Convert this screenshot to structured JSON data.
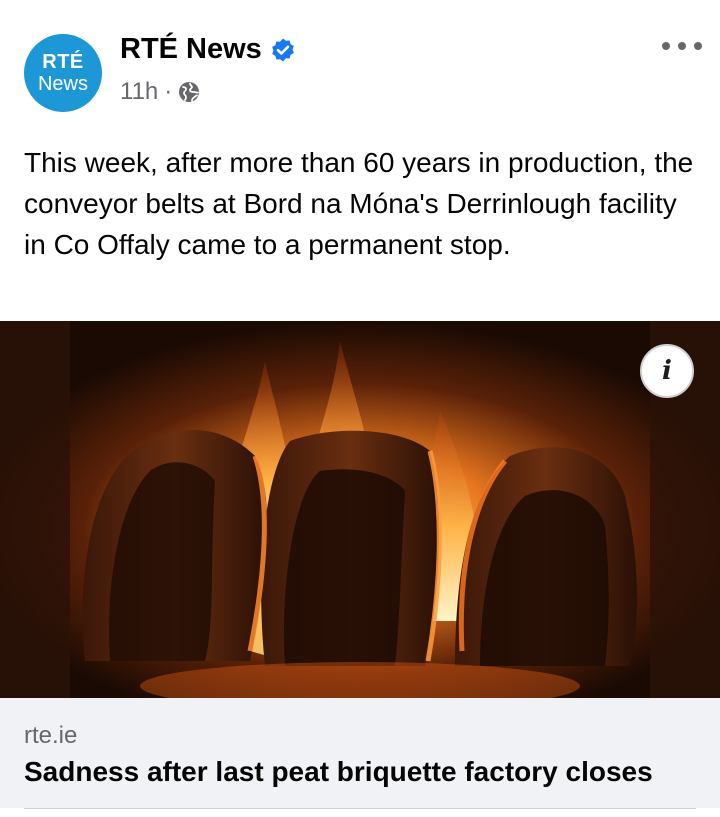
{
  "post": {
    "avatar": {
      "line1": "RTÉ",
      "line2": "News",
      "color": "#1e97d6"
    },
    "page_name": "RTÉ News",
    "verified_icon": "verified-badge-icon",
    "time": "11h",
    "separator": "·",
    "privacy_icon": "globe-icon",
    "more_icon": "more-options-icon",
    "text": "This week, after more than 60 years in production, the conveyor belts at Bord na Móna's Derrinlough facility in Co Offaly came to a permanent stop.",
    "image_icon": "info-icon",
    "info_label": "i"
  },
  "link": {
    "domain": "rte.ie",
    "title": "Sadness after last peat briquette factory closes",
    "background": "#f0f2f5"
  }
}
